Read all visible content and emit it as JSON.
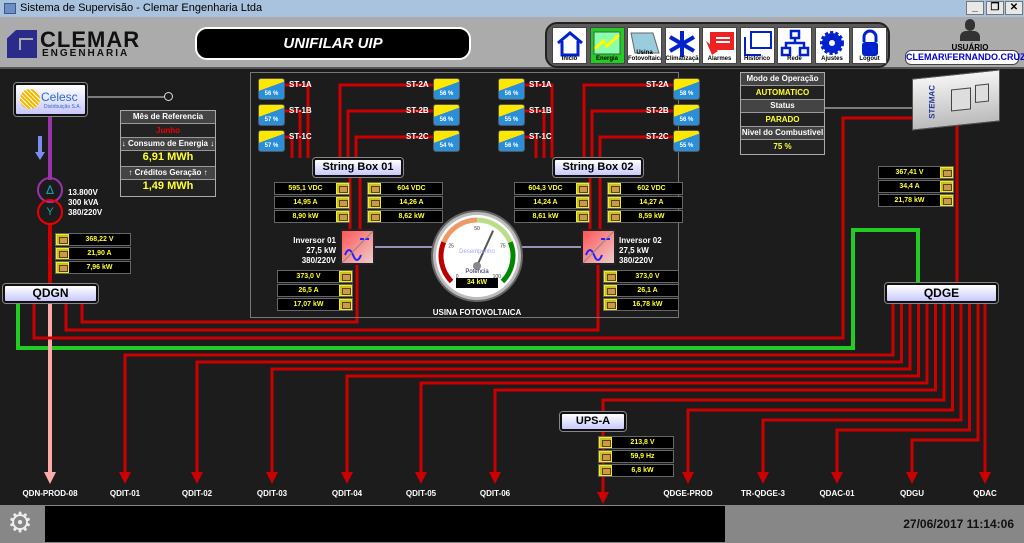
{
  "window": {
    "title": "Sistema de Supervisão - Clemar Engenharia Ltda",
    "minimize": "_",
    "restore": "❐",
    "close": "✕"
  },
  "header": {
    "logo_top": "CLEMAR",
    "logo_bottom": "ENGENHARIA",
    "screen_title": "UNIFILAR UIP",
    "nav": [
      {
        "label": "Inicio",
        "icon": "home-icon"
      },
      {
        "label": "Energia",
        "icon": "energy-chart-icon",
        "active": true
      },
      {
        "label": "Usina Fotovoltaica",
        "icon": "solar-panel-icon"
      },
      {
        "label": "Climatização",
        "icon": "snowflake-icon"
      },
      {
        "label": "Alarmes",
        "icon": "alarm-icon"
      },
      {
        "label": "Histórico",
        "icon": "history-icon"
      },
      {
        "label": "Rede",
        "icon": "network-icon"
      },
      {
        "label": "Ajustes",
        "icon": "gear-icon"
      },
      {
        "label": "Logout",
        "icon": "lock-icon"
      }
    ],
    "user_label": "USUÁRIO",
    "user_name": "CLEMAR\\FERNANDO.CRUZ"
  },
  "utility": {
    "name": "Celesc",
    "sub": "Distribuição S.A.",
    "reference": {
      "month_header": "Mês de Referencia",
      "month": "Junho",
      "consumption_header": "Consumo de Energia",
      "consumption": "6,91 MWh",
      "credits_header": "Créditos Geração",
      "credits": "1,49 MWh"
    },
    "transformer": {
      "primary": "13.800V",
      "power": "300 kVA",
      "secondary": "380/220V",
      "delta": "Δ",
      "wye": "Y"
    },
    "meters": [
      "368,22 V",
      "21,90 A",
      "7,96 kW"
    ]
  },
  "qdgn": {
    "label": "QDGN"
  },
  "qdge": {
    "label": "QDGE",
    "meters": [
      "367,41 V",
      "34,4 A",
      "21,78 kW"
    ]
  },
  "generator": {
    "brand": "STEMAC",
    "mode_header": "Modo de Operação",
    "mode": "AUTOMATICO",
    "status_header": "Status",
    "status": "PARADO",
    "fuel_header": "Nivel do Combustivel",
    "fuel": "75 %"
  },
  "pv": {
    "title": "USINA FOTOVOLTAICA",
    "string_boxes": [
      {
        "label": "String Box 01",
        "strings": [
          {
            "name": "ST-1A",
            "pct": "56 %"
          },
          {
            "name": "ST-1B",
            "pct": "57 %"
          },
          {
            "name": "ST-1C",
            "pct": "57 %"
          },
          {
            "name": "ST-2A",
            "pct": "56 %"
          },
          {
            "name": "ST-2B",
            "pct": "56 %"
          },
          {
            "name": "ST-2C",
            "pct": "54 %"
          }
        ],
        "meters_left": [
          "595,1 VDC",
          "14,95 A",
          "8,90 kW"
        ],
        "meters_right": [
          "604 VDC",
          "14,26 A",
          "8,62 kW"
        ],
        "inverter": {
          "name": "Inversor 01",
          "power": "27,5 kW",
          "voltage": "380/220V"
        },
        "inverter_meters": [
          "373,0 V",
          "26,5 A",
          "17,07 kW"
        ]
      },
      {
        "label": "String Box 02",
        "strings": [
          {
            "name": "ST-1A",
            "pct": "56 %"
          },
          {
            "name": "ST-1B",
            "pct": "55 %"
          },
          {
            "name": "ST-1C",
            "pct": "56 %"
          },
          {
            "name": "ST-2A",
            "pct": "58 %"
          },
          {
            "name": "ST-2B",
            "pct": "56 %"
          },
          {
            "name": "ST-2C",
            "pct": "55 %"
          }
        ],
        "meters_left": [
          "604,3 VDC",
          "14,24 A",
          "8,61 kW"
        ],
        "meters_right": [
          "602 VDC",
          "14,27 A",
          "8,59 kW"
        ],
        "inverter": {
          "name": "Inversor 02",
          "power": "27,5 kW",
          "voltage": "380/220V"
        },
        "inverter_meters": [
          "373,0 V",
          "26,1 A",
          "16,78 kW"
        ]
      }
    ],
    "gauge": {
      "label": "Desempenho",
      "sub": "Potencia",
      "value": "34 kW",
      "percent": 62,
      "ticks": [
        "0",
        "25",
        "50",
        "75",
        "100"
      ]
    }
  },
  "ups": {
    "label": "UPS-A",
    "meters": [
      "213,8 V",
      "59,9 Hz",
      "6,8 kW"
    ]
  },
  "feeders": [
    "QDN-PROD-08",
    "QDIT-01",
    "QDIT-02",
    "QDIT-03",
    "QDIT-04",
    "QDIT-05",
    "QDIT-06",
    "QDGE-PROD",
    "TR-QDGE-3",
    "QDAC-01",
    "QDGU",
    "QDAC"
  ],
  "footer": {
    "datetime": "27/06/2017 11:14:06",
    "message": ""
  },
  "colors": {
    "wire": "#cc0000",
    "green": "#22cc22",
    "pink": "#ffaaaa",
    "purple": "#9933aa",
    "accent": "#ffff33"
  }
}
